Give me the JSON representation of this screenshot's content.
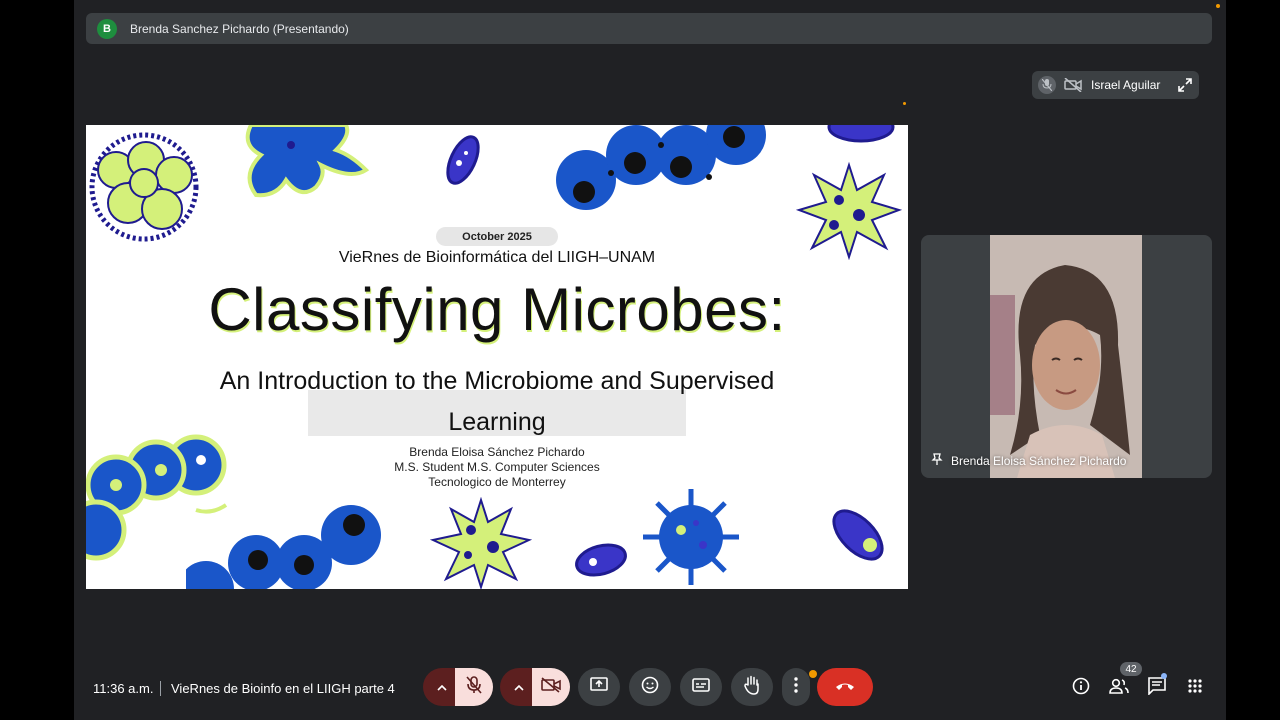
{
  "presenter": {
    "avatar_initial": "B",
    "name": "Brenda Sanchez Pichardo (Presentando)"
  },
  "slide": {
    "date": "October 2025",
    "series": "VieRnes de Bioinformática del LIIGH–UNAM",
    "title": "Classifying Microbes:",
    "subtitle_line1": "An Introduction to the Microbiome and Supervised",
    "subtitle_line2": "Learning",
    "author_name": "Brenda Eloisa Sánchez Pichardo",
    "author_degree": "M.S. Student M.S. Computer Sciences",
    "author_institution": "Tecnologico de Monterrey",
    "colors": {
      "lime": "#d4f07a",
      "blue": "#1a56c9",
      "navy": "#1f1b8f"
    }
  },
  "floating_participant": {
    "name": "Israel Aguilar",
    "icons": [
      "mic-off-icon",
      "camera-off-icon",
      "expand-icon"
    ]
  },
  "video_tile": {
    "name": "Brenda Eloisa Sánchez Pichardo",
    "icon": "pin-icon"
  },
  "bottom_bar": {
    "time": "11:36 a.m.",
    "meeting_title": "VieRnes de Bioinfo en el LIIGH parte 4",
    "controls": [
      "mic-options",
      "mic-off",
      "camera-options",
      "camera-off",
      "present",
      "emoji",
      "captions",
      "raise-hand",
      "more-options",
      "leave-call"
    ],
    "people_count": "42"
  },
  "colors": {
    "background": "#202124",
    "surface": "#3c4043",
    "danger": "#d93025",
    "muted_bg": "#f9dedc",
    "accent_orange": "#f29900"
  }
}
